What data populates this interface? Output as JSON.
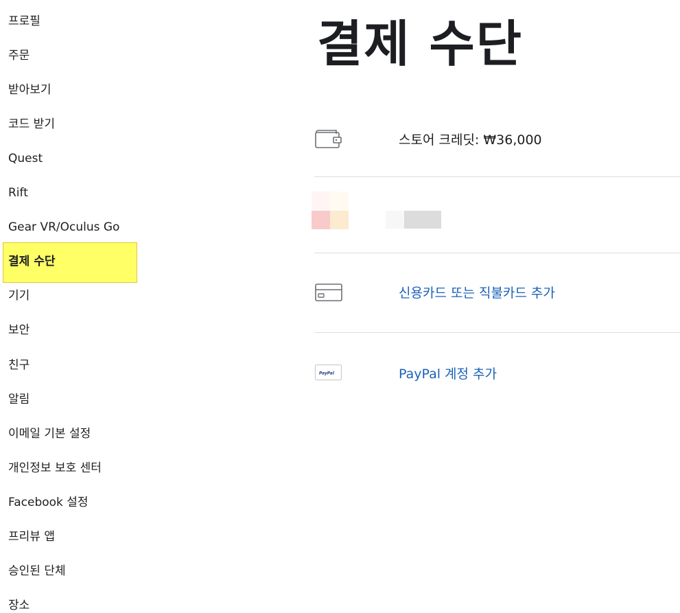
{
  "sidebar": {
    "items": [
      {
        "label": "프로필",
        "name": "sidebar-item-profile"
      },
      {
        "label": "주문",
        "name": "sidebar-item-orders"
      },
      {
        "label": "받아보기",
        "name": "sidebar-item-subscriptions"
      },
      {
        "label": "코드 받기",
        "name": "sidebar-item-redeem-code"
      },
      {
        "label": "Quest",
        "name": "sidebar-item-quest"
      },
      {
        "label": "Rift",
        "name": "sidebar-item-rift"
      },
      {
        "label": "Gear VR/Oculus Go",
        "name": "sidebar-item-gearvr-go"
      },
      {
        "label": "결제 수단",
        "name": "sidebar-item-payment-methods",
        "active": true
      },
      {
        "label": "기기",
        "name": "sidebar-item-devices"
      },
      {
        "label": "보안",
        "name": "sidebar-item-security"
      },
      {
        "label": "친구",
        "name": "sidebar-item-friends"
      },
      {
        "label": "알림",
        "name": "sidebar-item-notifications"
      },
      {
        "label": "이메일 기본 설정",
        "name": "sidebar-item-email-preferences"
      },
      {
        "label": "개인정보 보호 센터",
        "name": "sidebar-item-privacy-center"
      },
      {
        "label": "Facebook 설정",
        "name": "sidebar-item-facebook-settings"
      },
      {
        "label": "프리뷰 앱",
        "name": "sidebar-item-preview-apps"
      },
      {
        "label": "승인된 단체",
        "name": "sidebar-item-authorized-orgs"
      },
      {
        "label": "장소",
        "name": "sidebar-item-locations"
      }
    ]
  },
  "main": {
    "title": "결제 수단",
    "store_credit": {
      "label": "스토어 크레딧: ₩36,000",
      "icon": "wallet-icon"
    },
    "add_card": {
      "label": "신용카드 또는 직불카드 추가",
      "icon": "credit-card-icon"
    },
    "add_paypal": {
      "label": "PayPal 계정 추가",
      "icon": "paypal-icon",
      "icon_text": "PayPal"
    }
  },
  "colors": {
    "link": "#1a62b8",
    "highlight": "#ffff66",
    "divider": "#dadde1"
  }
}
